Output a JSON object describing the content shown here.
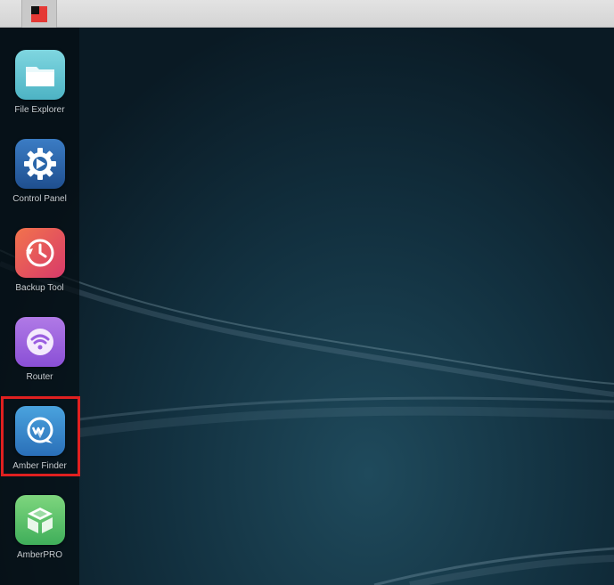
{
  "taskbar": {
    "start_icon": "grid-logo-icon",
    "start_colors": [
      "#111111",
      "#e53935",
      "#e53935",
      "#e53935"
    ]
  },
  "desktop": {
    "apps": [
      {
        "label": "File Explorer",
        "icon": "folder-icon",
        "color_from": "#7fd6e0",
        "color_to": "#4db3c4"
      },
      {
        "label": "Control Panel",
        "icon": "gear-icon",
        "color_from": "#3b7cc4",
        "color_to": "#1f4f8f"
      },
      {
        "label": "Backup Tool",
        "icon": "clock-history-icon",
        "color_from": "#f2734c",
        "color_to": "#d83a6a"
      },
      {
        "label": "Router",
        "icon": "wifi-icon",
        "color_from": "#b07ae6",
        "color_to": "#8a4fd6"
      },
      {
        "label": "Amber Finder",
        "icon": "chat-search-icon",
        "color_from": "#4aa3de",
        "color_to": "#2a6fb8"
      },
      {
        "label": "AmberPRO",
        "icon": "cube-icon",
        "color_from": "#7ed67e",
        "color_to": "#3fae5a"
      }
    ],
    "highlight_color": "#e02020"
  }
}
